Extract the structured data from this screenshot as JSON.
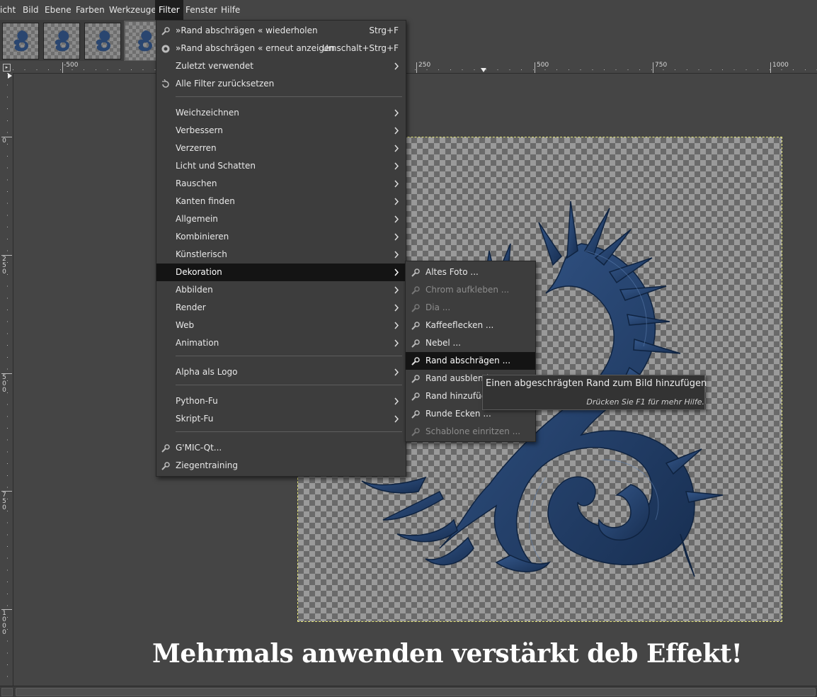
{
  "menubar": {
    "items": [
      "icht",
      "Bild",
      "Ebene",
      "Farben",
      "Werkzeuge",
      "Filter",
      "Fenster",
      "Hilfe"
    ],
    "active": "Filter"
  },
  "ruler": {
    "h_labels": [
      "-500",
      "250",
      "500",
      "750",
      "1000"
    ],
    "v_labels": [
      "0",
      "250",
      "500",
      "750",
      "1000"
    ]
  },
  "filter_menu": {
    "items": [
      {
        "label": "»Rand abschrägen « wiederholen",
        "accel": "Strg+F",
        "icon": "gear-icon"
      },
      {
        "label": "»Rand abschrägen « erneut anzeigen",
        "accel": "Umschalt+Strg+F",
        "icon": "reshow-icon"
      },
      {
        "label": "Zuletzt verwendet",
        "submenu": true
      },
      {
        "label": "Alle Filter zurücksetzen",
        "icon": "reset-icon"
      },
      {
        "label": "Weichzeichnen",
        "submenu": true
      },
      {
        "label": "Verbessern",
        "submenu": true
      },
      {
        "label": "Verzerren",
        "submenu": true
      },
      {
        "label": "Licht und Schatten",
        "submenu": true
      },
      {
        "label": "Rauschen",
        "submenu": true
      },
      {
        "label": "Kanten finden",
        "submenu": true
      },
      {
        "label": "Allgemein",
        "submenu": true
      },
      {
        "label": "Kombinieren",
        "submenu": true
      },
      {
        "label": "Künstlerisch",
        "submenu": true
      },
      {
        "label": "Dekoration",
        "submenu": true,
        "highlighted": true
      },
      {
        "label": "Abbilden",
        "submenu": true
      },
      {
        "label": "Render",
        "submenu": true
      },
      {
        "label": "Web",
        "submenu": true
      },
      {
        "label": "Animation",
        "submenu": true
      },
      {
        "label": "Alpha als Logo",
        "submenu": true
      },
      {
        "label": "Python-Fu",
        "submenu": true
      },
      {
        "label": "Skript-Fu",
        "submenu": true
      },
      {
        "label": "G'MIC-Qt...",
        "icon": "gear-icon"
      },
      {
        "label": "Ziegentraining",
        "icon": "gear-icon"
      }
    ]
  },
  "dekoration_menu": {
    "items": [
      {
        "label": "Altes Foto ...",
        "enabled": true
      },
      {
        "label": "Chrom aufkleben ...",
        "enabled": false
      },
      {
        "label": "Dia ...",
        "enabled": false
      },
      {
        "label": "Kaffeeflecken ...",
        "enabled": true
      },
      {
        "label": "Nebel ...",
        "enabled": true
      },
      {
        "label": "Rand abschrägen ...",
        "enabled": true,
        "highlighted": true
      },
      {
        "label": "Rand ausblenden ...",
        "enabled": true
      },
      {
        "label": "Rand hinzufügen ...",
        "enabled": true
      },
      {
        "label": "Runde Ecken ...",
        "enabled": true
      },
      {
        "label": "Schablone einritzen ...",
        "enabled": false
      }
    ]
  },
  "tooltip": {
    "title": "Einen abgeschrägten Rand zum Bild hinzufügen",
    "hint": "Drücken Sie F1 für mehr Hilfe."
  },
  "caption": "Mehrmals anwenden verstärkt deb Effekt!",
  "colors": {
    "dragon": "#1f3a63",
    "menu_bg": "#3d3d3d",
    "highlight": "#141414",
    "workspace": "#454545"
  }
}
